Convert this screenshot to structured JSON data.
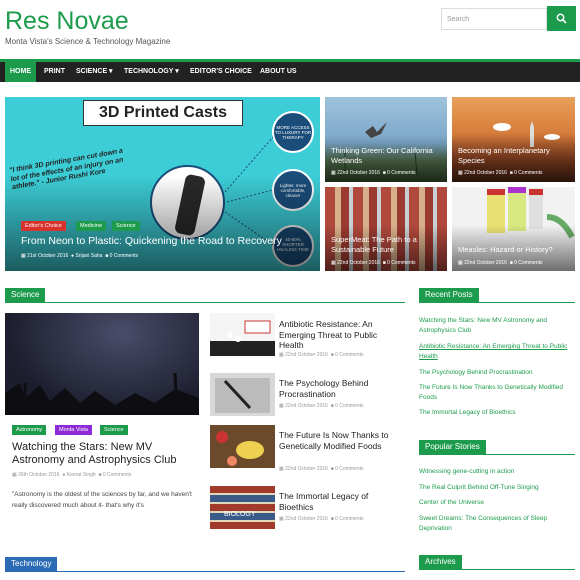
{
  "site": {
    "title": "Res Novae",
    "tagline": "Monta Vista's Science & Technology Magazine"
  },
  "search": {
    "placeholder": "Search"
  },
  "nav": {
    "items": [
      "HOME",
      "PRINT",
      "SCIENCE ▾",
      "TECHNOLOGY ▾",
      "EDITOR'S CHOICE",
      "ABOUT US"
    ]
  },
  "featured": {
    "main": {
      "image_title": "3D Printed Casts",
      "quote": "\"I think 3D printing can cut down a lot of the effects of an injury on an athlete.\" - Junior Rushi Kore",
      "bubbles": [
        "MORE ACCESS TO LUXURY FOR THERAPY",
        "Lighter, more comfortable, cleaner",
        "40-80% SHORTER HEALING TIME"
      ],
      "tags": [
        "Editor's Choice",
        "Medicine",
        "Science"
      ],
      "title": "From Neon to Plastic: Quickening the Road to Recovery",
      "date": "21st October 2016",
      "author": "Srijani Saha",
      "comments": "0 Comments"
    },
    "tiles": [
      {
        "title": "Thinking Green: Our California Wetlands",
        "date": "22nd October 2016",
        "comments": "0 Comments"
      },
      {
        "title": "Becoming an Interplanetary Species",
        "date": "22nd October 2016",
        "comments": "0 Comments"
      },
      {
        "title": "SuperMeat: The Path to a Sustainable Future",
        "date": "22nd October 2016",
        "comments": "0 Comments"
      },
      {
        "title": "Measles: Hazard or History?",
        "date": "22nd October 2016",
        "comments": "0 Comments"
      }
    ]
  },
  "science": {
    "heading": "Science",
    "lead": {
      "tags": [
        "Astronomy",
        "Monta Vista",
        "Science"
      ],
      "title": "Watching the Stars: New MV Astronomy and Astrophysics Club",
      "date": "26th October 2016",
      "author": "Keerat Singh",
      "comments": "0 Comments",
      "excerpt": "\"Astronomy is the oldest of the sciences by far, and we haven't really discovered much about it- that's why it's"
    },
    "articles": [
      {
        "title": "Antibiotic Resistance: An Emerging Threat to Public Health",
        "date": "22nd October 2016",
        "comments": "0 Comments"
      },
      {
        "title": "The Psychology Behind Procrastination",
        "date": "22nd October 2016",
        "comments": "0 Comments"
      },
      {
        "title": "The Future Is Now Thanks to Genetically Modified Foods",
        "date": "22nd October 2016",
        "comments": "0 Comments"
      },
      {
        "title": "The Immortal Legacy of Bioethics",
        "date": "22nd October 2016",
        "comments": "0 Comments"
      }
    ]
  },
  "technology": {
    "heading": "Technology"
  },
  "sidebar": {
    "recent": {
      "heading": "Recent Posts",
      "items": [
        "Watching the Stars: New MV Astronomy and Astrophysics Club",
        "Antibiotic Resistance: An Emerging Threat to Public Health",
        "The Psychology Behind Procrastination",
        "The Future Is Now Thanks to Genetically Modified Foods",
        "The Immortal Legacy of Bioethics"
      ]
    },
    "popular": {
      "heading": "Popular Stories",
      "items": [
        "Witnessing gene-cutting in action",
        "The Real Culprit Behind Off-Tune Singing",
        "Center of the Universe",
        "Sweet Dreams: The Consequences of Sleep Deprivation"
      ]
    },
    "archives": {
      "heading": "Archives"
    }
  },
  "colors": {
    "accent": "#1d9b4c",
    "nav_bg": "#222222",
    "tag_red": "#d9312b",
    "tag_purple": "#8e2bd6",
    "tech_blue": "#2a6bb3"
  }
}
